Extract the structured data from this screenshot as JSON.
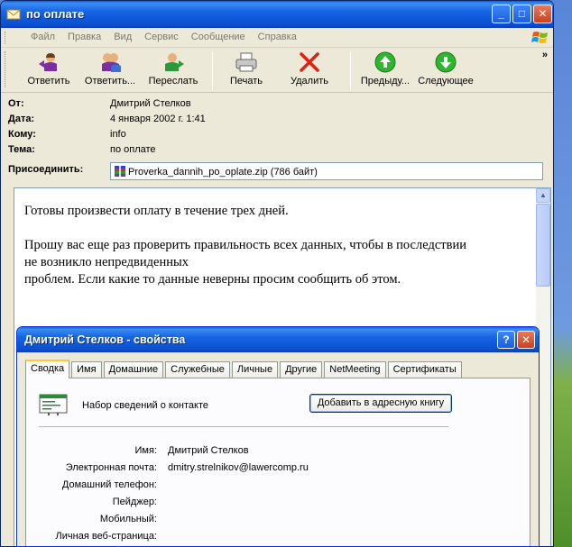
{
  "window": {
    "title": "по оплате"
  },
  "menu": [
    "Файл",
    "Правка",
    "Вид",
    "Сервис",
    "Сообщение",
    "Справка"
  ],
  "toolbar": {
    "reply": "Ответить",
    "reply_all": "Ответить...",
    "forward": "Переслать",
    "print": "Печать",
    "delete": "Удалить",
    "previous": "Предыду...",
    "next": "Следующее",
    "more": "»"
  },
  "header": {
    "from_label": "От:",
    "from": "Дмитрий Стелков",
    "date_label": "Дата:",
    "date": "4 января 2002 г. 1:41",
    "to_label": "Кому:",
    "to": "info",
    "subject_label": "Тема:",
    "subject": "по оплате",
    "attach_label": "Присоединить:",
    "attachment": "Proverka_dannih_po_oplate.zip (786 байт)"
  },
  "message": {
    "line1": "Готовы произвести оплату в течение трех дней.",
    "line2": "Прошу вас еще раз проверить правильность всех данных, чтобы в последствии",
    "line3": "не возникло непредвиденных",
    "line4": "проблем. Если какие то данные неверны просим сообщить об этом."
  },
  "dialog": {
    "title": "Дмитрий Стелков - свойства",
    "help_button": "?",
    "tabs": [
      "Сводка",
      "Имя",
      "Домашние",
      "Служебные",
      "Личные",
      "Другие",
      "NetMeeting",
      "Сертификаты"
    ],
    "intro": "Набор сведений о контакте",
    "add_button": "Добавить в адресную книгу",
    "fields": [
      {
        "label": "Имя:",
        "value": "Дмитрий Стелков"
      },
      {
        "label": "Электронная почта:",
        "value": "dmitry.strelnikov@lawercomp.ru"
      },
      {
        "label": "Домашний телефон:",
        "value": ""
      },
      {
        "label": "Пейджер:",
        "value": ""
      },
      {
        "label": "Мобильный:",
        "value": ""
      },
      {
        "label": "Личная веб-страница:",
        "value": ""
      }
    ]
  },
  "colors": {
    "titlebar": "#0a5fd8",
    "window_bg": "#ece9d8",
    "tab_highlight": "#ffc83c"
  },
  "icons": [
    "envelope-icon",
    "reply-icon",
    "reply-all-icon",
    "forward-icon",
    "printer-icon",
    "delete-icon",
    "previous-icon",
    "next-icon",
    "zip-icon",
    "contact-card-icon",
    "windows-logo-icon"
  ]
}
